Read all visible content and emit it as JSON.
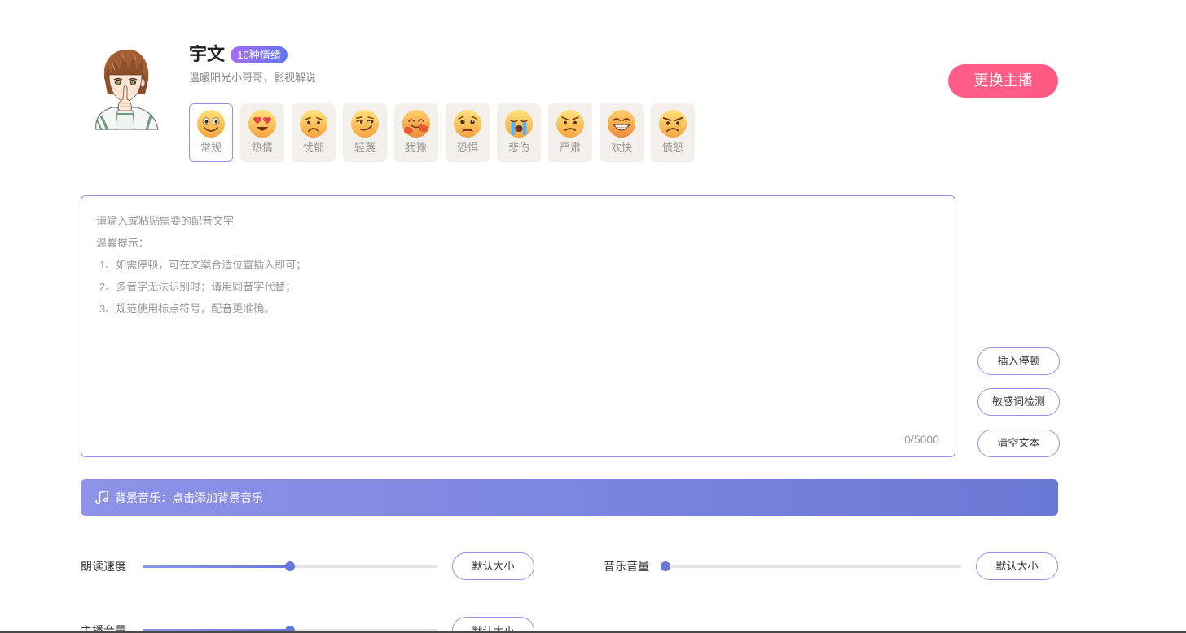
{
  "anchor": {
    "name": "宇文",
    "badge": "10种情绪",
    "description": "温暖阳光小哥哥，影视解说",
    "avatar_icon": "anime-boy-avatar",
    "change_button": "更换主播"
  },
  "emotions": [
    {
      "label": "常规",
      "icon": "smiling-face-icon",
      "selected": true
    },
    {
      "label": "热情",
      "icon": "heart-eyes-face-icon",
      "selected": false
    },
    {
      "label": "忧郁",
      "icon": "sad-face-icon",
      "selected": false
    },
    {
      "label": "轻蔑",
      "icon": "smirking-face-icon",
      "selected": false
    },
    {
      "label": "犹豫",
      "icon": "hugging-face-icon",
      "selected": false
    },
    {
      "label": "恐惧",
      "icon": "worried-face-icon",
      "selected": false
    },
    {
      "label": "悲伤",
      "icon": "crying-face-icon",
      "selected": false
    },
    {
      "label": "严肃",
      "icon": "frowning-face-icon",
      "selected": false
    },
    {
      "label": "欢快",
      "icon": "grinning-face-icon",
      "selected": false
    },
    {
      "label": "愤怒",
      "icon": "angry-face-icon",
      "selected": false
    }
  ],
  "editor": {
    "hint_lines": [
      "请输入或粘贴需要的配音文字",
      "温馨提示：",
      "1、如需停顿，可在文案合适位置插入即可；",
      "2、多音字无法识别时；请用同音字代替；",
      "3、规范使用标点符号，配音更准确。"
    ],
    "counter": "0/5000"
  },
  "side_actions": {
    "insert_pause": "插入停顿",
    "sensitive_check": "敏感词检测",
    "clear_text": "清空文本"
  },
  "music_bar": {
    "icon": "music-note-icon",
    "label": "背景音乐：点击添加背景音乐"
  },
  "controls": [
    {
      "label": "朗读速度",
      "level": 0.5,
      "reset_label": "默认大小"
    },
    {
      "label": "音乐音量",
      "level": 0.0,
      "reset_label": "默认大小"
    },
    {
      "label": "主播音量",
      "level": 0.5,
      "reset_label": "默认大小"
    }
  ],
  "colors": {
    "accent": "#8e96e2",
    "brand": "#ff5a84",
    "tile_bg": "#f3f0eb",
    "music_start": "#8e93e9",
    "music_end": "#6a78d5",
    "slider": "#6677d8"
  }
}
